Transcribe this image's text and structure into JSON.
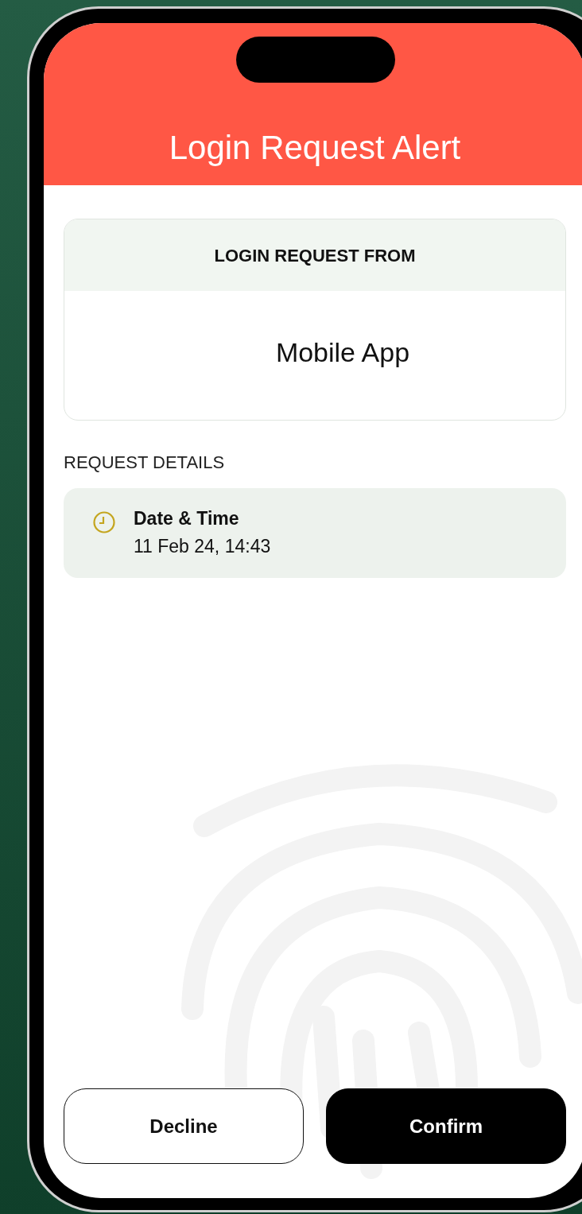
{
  "header": {
    "title": "Login Request Alert"
  },
  "request_source": {
    "label": "LOGIN REQUEST FROM",
    "value": "Mobile App"
  },
  "details": {
    "heading": "REQUEST DETAILS",
    "items": [
      {
        "label": "Date & Time",
        "value": "11 Feb 24, 14:43"
      }
    ]
  },
  "buttons": [
    {
      "label": "Decline",
      "kind": "secondary"
    },
    {
      "label": "Confirm",
      "kind": "primary"
    }
  ]
}
